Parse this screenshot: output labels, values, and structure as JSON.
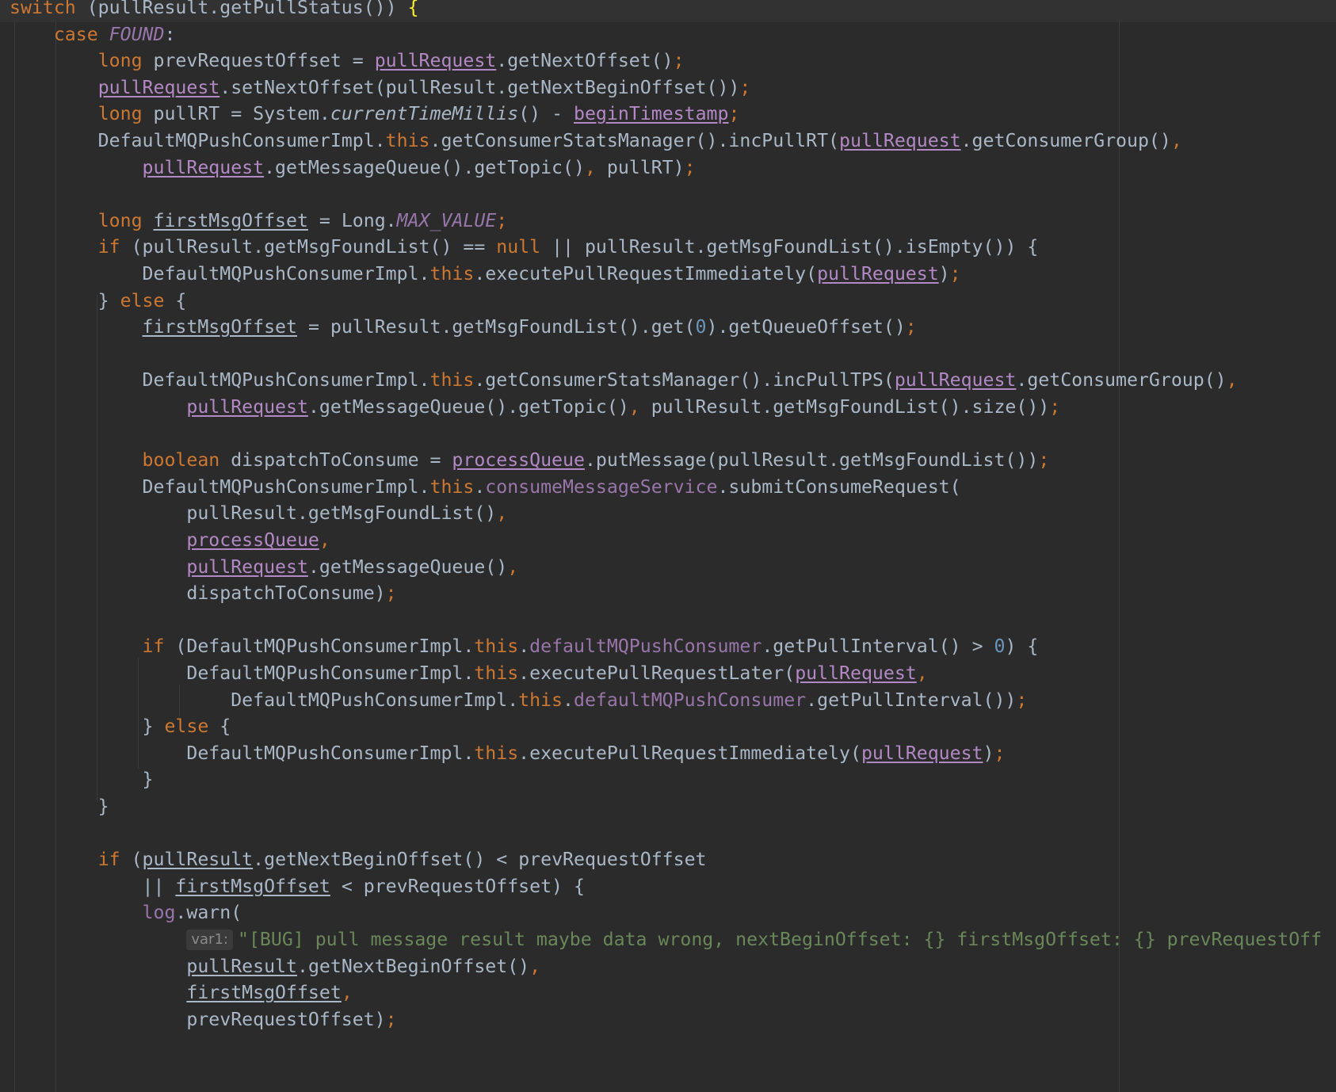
{
  "editor": {
    "colors": {
      "background": "#2b2b2b",
      "keyword": "#cc7832",
      "identifier": "#a9b7c6",
      "field": "#9876aa",
      "number": "#6897bb",
      "string": "#6a8759",
      "matched_brace": "#ffef28"
    },
    "lines": [
      [
        {
          "t": "switch",
          "c": "kw"
        },
        {
          "t": " (pullResult.getPullStatus()) "
        },
        {
          "t": "{",
          "c": "brace-hl"
        }
      ],
      [
        {
          "t": "    "
        },
        {
          "t": "case ",
          "c": "kw"
        },
        {
          "t": "FOUND",
          "c": "fieldi"
        },
        {
          "t": ":"
        }
      ],
      [
        {
          "t": "        "
        },
        {
          "t": "long ",
          "c": "kw"
        },
        {
          "t": "prevRequestOffset = "
        },
        {
          "t": "pullRequest",
          "c": "ulp"
        },
        {
          "t": ".getNextOffset()"
        },
        {
          "t": ";",
          "c": "kw"
        }
      ],
      [
        {
          "t": "        "
        },
        {
          "t": "pullRequest",
          "c": "ulp"
        },
        {
          "t": ".setNextOffset(pullResult.getNextBeginOffset())"
        },
        {
          "t": ";",
          "c": "kw"
        }
      ],
      [
        {
          "t": "        "
        },
        {
          "t": "long ",
          "c": "kw"
        },
        {
          "t": "pullRT = System."
        },
        {
          "t": "currentTimeMillis",
          "c": "ital"
        },
        {
          "t": "() - "
        },
        {
          "t": "beginTimestamp",
          "c": "ulp"
        },
        {
          "t": ";",
          "c": "kw"
        }
      ],
      [
        {
          "t": "        DefaultMQPushConsumerImpl."
        },
        {
          "t": "this",
          "c": "kw"
        },
        {
          "t": ".getConsumerStatsManager().incPullRT("
        },
        {
          "t": "pullRequest",
          "c": "ulp"
        },
        {
          "t": ".getConsumerGroup()"
        },
        {
          "t": ",",
          "c": "kw"
        }
      ],
      [
        {
          "t": "            "
        },
        {
          "t": "pullRequest",
          "c": "ulp"
        },
        {
          "t": ".getMessageQueue().getTopic()"
        },
        {
          "t": ", ",
          "c": "kw"
        },
        {
          "t": "pullRT)"
        },
        {
          "t": ";",
          "c": "kw"
        }
      ],
      [],
      [
        {
          "t": "        "
        },
        {
          "t": "long ",
          "c": "kw"
        },
        {
          "t": "firstMsgOffset",
          "c": "ul"
        },
        {
          "t": " = Long."
        },
        {
          "t": "MAX_VALUE",
          "c": "fieldi"
        },
        {
          "t": ";",
          "c": "kw"
        }
      ],
      [
        {
          "t": "        "
        },
        {
          "t": "if ",
          "c": "kw"
        },
        {
          "t": "(pullResult.getMsgFoundList() == "
        },
        {
          "t": "null ",
          "c": "kw"
        },
        {
          "t": "|| pullResult.getMsgFoundList().isEmpty()) {"
        }
      ],
      [
        {
          "t": "            DefaultMQPushConsumerImpl."
        },
        {
          "t": "this",
          "c": "kw"
        },
        {
          "t": ".executePullRequestImmediately("
        },
        {
          "t": "pullRequest",
          "c": "ulp"
        },
        {
          "t": ")"
        },
        {
          "t": ";",
          "c": "kw"
        }
      ],
      [
        {
          "t": "        } "
        },
        {
          "t": "else ",
          "c": "kw"
        },
        {
          "t": "{"
        }
      ],
      [
        {
          "t": "            "
        },
        {
          "t": "firstMsgOffset",
          "c": "ul"
        },
        {
          "t": " = pullResult.getMsgFoundList().get("
        },
        {
          "t": "0",
          "c": "num"
        },
        {
          "t": ").getQueueOffset()"
        },
        {
          "t": ";",
          "c": "kw"
        }
      ],
      [],
      [
        {
          "t": "            DefaultMQPushConsumerImpl."
        },
        {
          "t": "this",
          "c": "kw"
        },
        {
          "t": ".getConsumerStatsManager().incPullTPS("
        },
        {
          "t": "pullRequest",
          "c": "ulp"
        },
        {
          "t": ".getConsumerGroup()"
        },
        {
          "t": ",",
          "c": "kw"
        }
      ],
      [
        {
          "t": "                "
        },
        {
          "t": "pullRequest",
          "c": "ulp"
        },
        {
          "t": ".getMessageQueue().getTopic()"
        },
        {
          "t": ", ",
          "c": "kw"
        },
        {
          "t": "pullResult.getMsgFoundList().size())"
        },
        {
          "t": ";",
          "c": "kw"
        }
      ],
      [],
      [
        {
          "t": "            "
        },
        {
          "t": "boolean ",
          "c": "kw"
        },
        {
          "t": "dispatchToConsume = "
        },
        {
          "t": "processQueue",
          "c": "ulp"
        },
        {
          "t": ".putMessage(pullResult.getMsgFoundList())"
        },
        {
          "t": ";",
          "c": "kw"
        }
      ],
      [
        {
          "t": "            DefaultMQPushConsumerImpl."
        },
        {
          "t": "this",
          "c": "kw"
        },
        {
          "t": "."
        },
        {
          "t": "consumeMessageService",
          "c": "field"
        },
        {
          "t": ".submitConsumeRequest("
        }
      ],
      [
        {
          "t": "                pullResult.getMsgFoundList()"
        },
        {
          "t": ",",
          "c": "kw"
        }
      ],
      [
        {
          "t": "                "
        },
        {
          "t": "processQueue",
          "c": "ulp"
        },
        {
          "t": ",",
          "c": "kw"
        }
      ],
      [
        {
          "t": "                "
        },
        {
          "t": "pullRequest",
          "c": "ulp"
        },
        {
          "t": ".getMessageQueue()"
        },
        {
          "t": ",",
          "c": "kw"
        }
      ],
      [
        {
          "t": "                dispatchToConsume)"
        },
        {
          "t": ";",
          "c": "kw"
        }
      ],
      [],
      [
        {
          "t": "            "
        },
        {
          "t": "if ",
          "c": "kw"
        },
        {
          "t": "(DefaultMQPushConsumerImpl."
        },
        {
          "t": "this",
          "c": "kw"
        },
        {
          "t": "."
        },
        {
          "t": "defaultMQPushConsumer",
          "c": "field"
        },
        {
          "t": ".getPullInterval() > "
        },
        {
          "t": "0",
          "c": "num"
        },
        {
          "t": ") {"
        }
      ],
      [
        {
          "t": "                DefaultMQPushConsumerImpl."
        },
        {
          "t": "this",
          "c": "kw"
        },
        {
          "t": ".executePullRequestLater("
        },
        {
          "t": "pullRequest",
          "c": "ulp"
        },
        {
          "t": ",",
          "c": "kw"
        }
      ],
      [
        {
          "t": "                    DefaultMQPushConsumerImpl."
        },
        {
          "t": "this",
          "c": "kw"
        },
        {
          "t": "."
        },
        {
          "t": "defaultMQPushConsumer",
          "c": "field"
        },
        {
          "t": ".getPullInterval())"
        },
        {
          "t": ";",
          "c": "kw"
        }
      ],
      [
        {
          "t": "            } "
        },
        {
          "t": "else ",
          "c": "kw"
        },
        {
          "t": "{"
        }
      ],
      [
        {
          "t": "                DefaultMQPushConsumerImpl."
        },
        {
          "t": "this",
          "c": "kw"
        },
        {
          "t": ".executePullRequestImmediately("
        },
        {
          "t": "pullRequest",
          "c": "ulp"
        },
        {
          "t": ")"
        },
        {
          "t": ";",
          "c": "kw"
        }
      ],
      [
        {
          "t": "            }"
        }
      ],
      [
        {
          "t": "        }"
        }
      ],
      [],
      [
        {
          "t": "        "
        },
        {
          "t": "if ",
          "c": "kw"
        },
        {
          "t": "("
        },
        {
          "t": "pullResult",
          "c": "ul"
        },
        {
          "t": ".getNextBeginOffset() < prevRequestOffset"
        }
      ],
      [
        {
          "t": "            || "
        },
        {
          "t": "firstMsgOffset",
          "c": "ul"
        },
        {
          "t": " < prevRequestOffset) {"
        }
      ],
      [
        {
          "t": "            "
        },
        {
          "t": "log",
          "c": "field"
        },
        {
          "t": ".warn("
        }
      ],
      [
        {
          "t": "                "
        },
        {
          "t": "var1:",
          "c": "hint"
        },
        {
          "t": "\"[BUG] pull message result maybe data wrong, nextBeginOffset: {} firstMsgOffset: {} prevRequestOff",
          "c": "str"
        }
      ],
      [
        {
          "t": "                "
        },
        {
          "t": "pullResult",
          "c": "ul"
        },
        {
          "t": ".getNextBeginOffset()"
        },
        {
          "t": ",",
          "c": "kw"
        }
      ],
      [
        {
          "t": "                "
        },
        {
          "t": "firstMsgOffset",
          "c": "ul"
        },
        {
          "t": ",",
          "c": "kw"
        }
      ],
      [
        {
          "t": "                prevRequestOffset)"
        },
        {
          "t": ";",
          "c": "kw"
        }
      ]
    ]
  }
}
